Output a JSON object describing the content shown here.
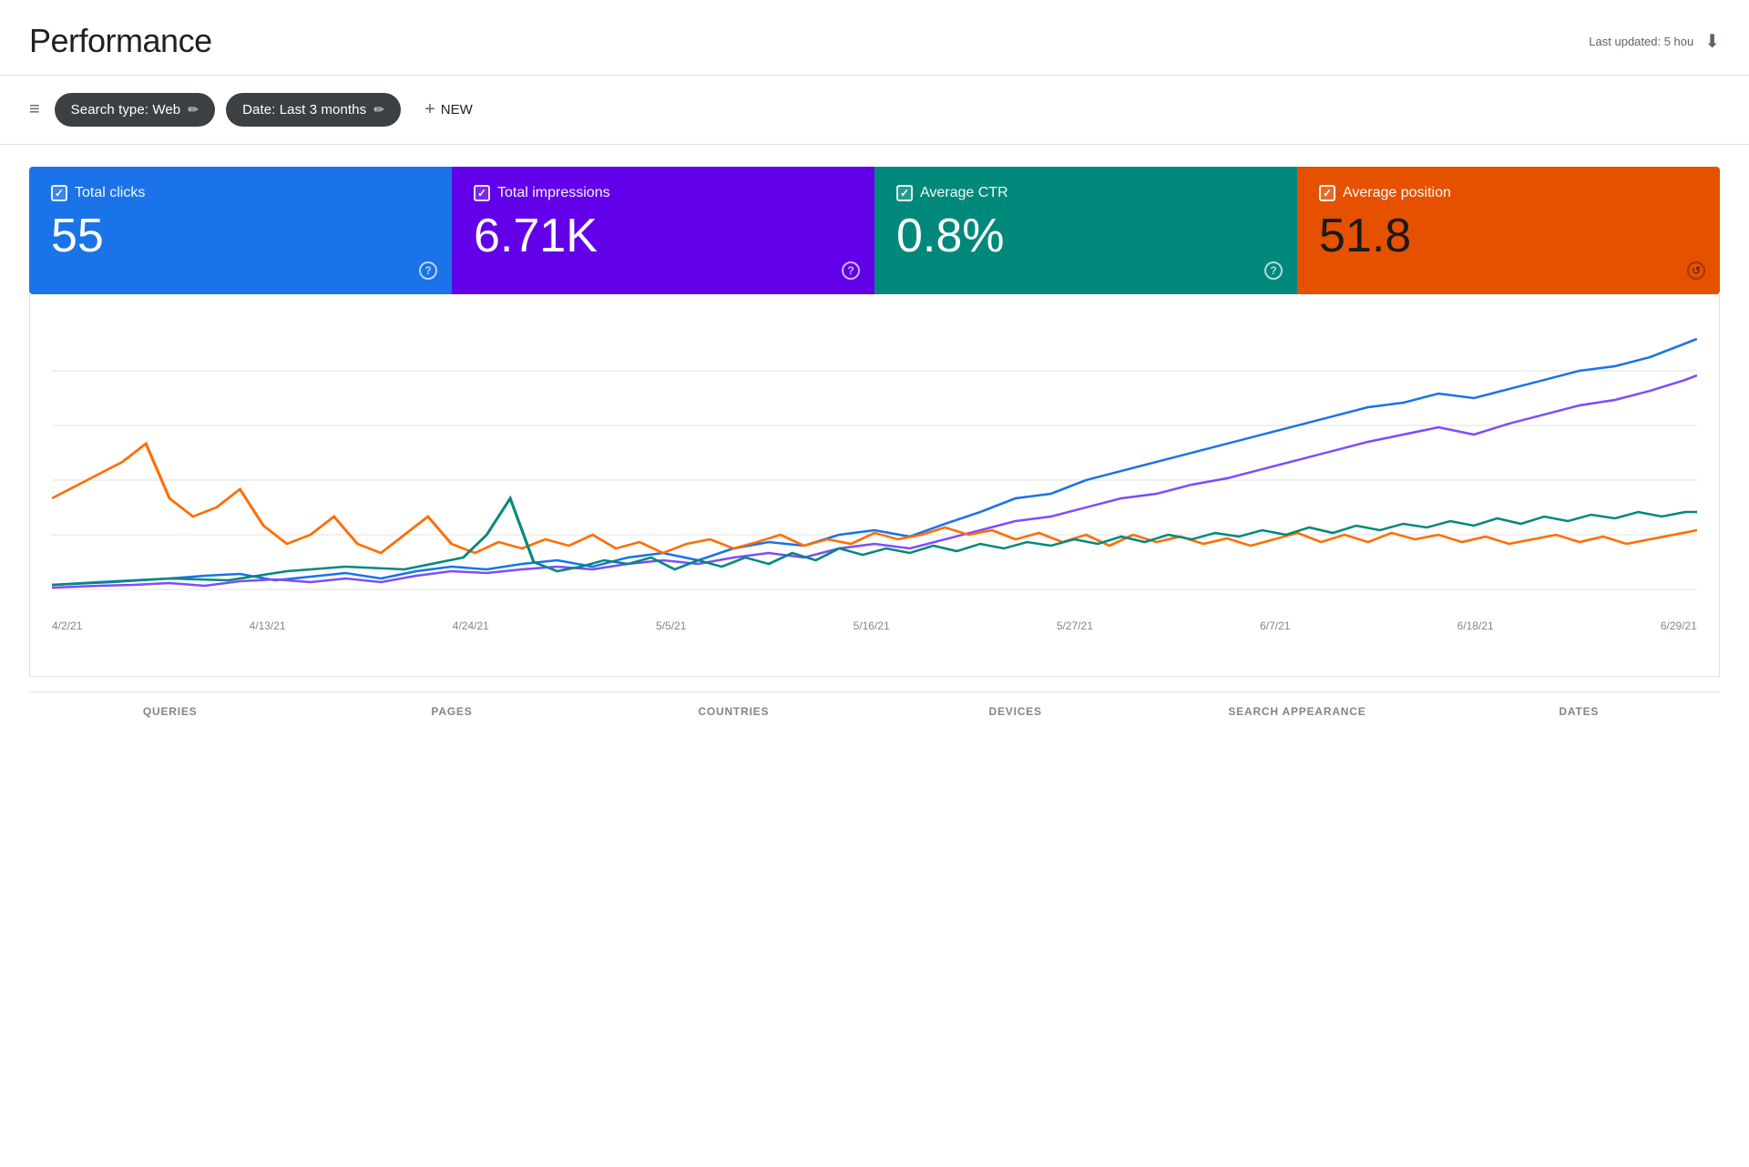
{
  "header": {
    "title": "Performance",
    "last_updated": "Last updated: 5 hou"
  },
  "toolbar": {
    "filter_label": "Search type: Web",
    "date_label": "Date: Last 3 months",
    "new_label": "NEW",
    "edit_icon": "✏",
    "plus_icon": "+"
  },
  "metrics": [
    {
      "id": "clicks",
      "label": "Total clicks",
      "value": "55",
      "color": "#1a73e8",
      "info": "?"
    },
    {
      "id": "impressions",
      "label": "Total impressions",
      "value": "6.71K",
      "color": "#6200ea",
      "info": "?"
    },
    {
      "id": "ctr",
      "label": "Average CTR",
      "value": "0.8%",
      "color": "#00897b",
      "info": "?"
    },
    {
      "id": "position",
      "label": "Average position",
      "value": "51.8",
      "color": "#e65100",
      "info": "↺"
    }
  ],
  "chart": {
    "x_labels": [
      "4/2/21",
      "4/13/21",
      "4/24/21",
      "5/5/21",
      "5/16/21",
      "5/27/21",
      "6/7/21",
      "6/18/21",
      "6/29/21"
    ]
  },
  "bottom_tabs": [
    {
      "id": "queries",
      "label": "QUERIES"
    },
    {
      "id": "pages",
      "label": "PAGES"
    },
    {
      "id": "countries",
      "label": "COUNTRIES"
    },
    {
      "id": "devices",
      "label": "DEVICES"
    },
    {
      "id": "search_appearance",
      "label": "SEARCH APPEARANCE"
    },
    {
      "id": "dates",
      "label": "DATES"
    }
  ]
}
